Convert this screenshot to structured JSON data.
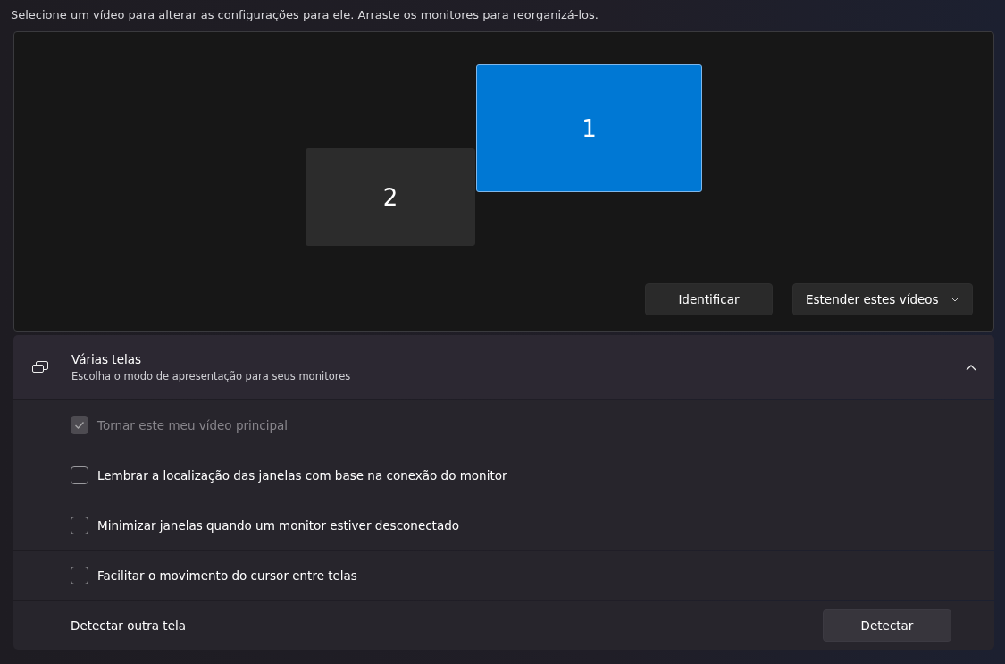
{
  "instructions": "Selecione um vídeo para alterar as configurações para ele. Arraste os monitores para reorganizá-los.",
  "monitors": [
    {
      "label": "1",
      "selected": true
    },
    {
      "label": "2",
      "selected": false
    }
  ],
  "identify_button": "Identificar",
  "mode_dropdown": {
    "value": "Estender estes vídeos"
  },
  "multiple_displays": {
    "title": "Várias telas",
    "subtitle": "Escolha o modo de apresentação para seus monitores",
    "expanded": true,
    "options": [
      {
        "label": "Tornar este meu vídeo principal",
        "checked": true,
        "disabled": true
      },
      {
        "label": "Lembrar a localização das janelas com base na conexão do monitor",
        "checked": false,
        "disabled": false
      },
      {
        "label": "Minimizar janelas quando um monitor estiver desconectado",
        "checked": false,
        "disabled": false
      },
      {
        "label": "Facilitar o movimento do cursor entre telas",
        "checked": false,
        "disabled": false
      }
    ],
    "detect": {
      "label": "Detectar outra tela",
      "button": "Detectar"
    }
  }
}
